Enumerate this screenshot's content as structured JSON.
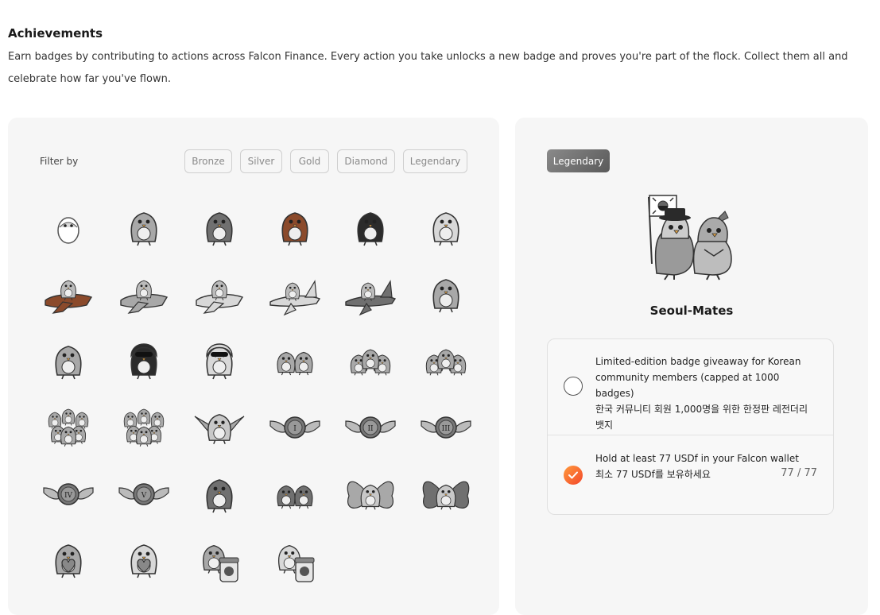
{
  "header": {
    "title": "Achievements",
    "description": "Earn badges by contributing to actions across Falcon Finance. Every action you take unlocks a new badge and proves you're part of the flock. Collect them all and celebrate how far you've flown."
  },
  "filters": {
    "label": "Filter by",
    "options": [
      "Bronze",
      "Silver",
      "Gold",
      "Diamond",
      "Legendary"
    ]
  },
  "badges": [
    {
      "kind": "egg",
      "tone": "light"
    },
    {
      "kind": "falcon",
      "tone": "mid"
    },
    {
      "kind": "falcon",
      "tone": "dark"
    },
    {
      "kind": "falcon",
      "tone": "brown"
    },
    {
      "kind": "falcon",
      "tone": "black"
    },
    {
      "kind": "falcon",
      "tone": "light"
    },
    {
      "kind": "plane",
      "tone": "brown"
    },
    {
      "kind": "plane",
      "tone": "mid"
    },
    {
      "kind": "plane",
      "tone": "light"
    },
    {
      "kind": "jet",
      "tone": "light"
    },
    {
      "kind": "jet",
      "tone": "dark"
    },
    {
      "kind": "falcon",
      "tone": "mid"
    },
    {
      "kind": "falcon",
      "tone": "mid"
    },
    {
      "kind": "hood",
      "tone": "black"
    },
    {
      "kind": "hood",
      "tone": "light"
    },
    {
      "kind": "pair",
      "tone": "mid"
    },
    {
      "kind": "trio",
      "tone": "mid"
    },
    {
      "kind": "trio",
      "tone": "mid"
    },
    {
      "kind": "flock",
      "tone": "mid"
    },
    {
      "kind": "flock",
      "tone": "mid"
    },
    {
      "kind": "wings",
      "tone": "mid"
    },
    {
      "kind": "emblem",
      "tone": "mid",
      "numeral": "I"
    },
    {
      "kind": "emblem",
      "tone": "mid",
      "numeral": "II"
    },
    {
      "kind": "emblem",
      "tone": "mid",
      "numeral": "III"
    },
    {
      "kind": "emblem",
      "tone": "mid",
      "numeral": "IV"
    },
    {
      "kind": "emblem",
      "tone": "mid",
      "numeral": "V"
    },
    {
      "kind": "falcon",
      "tone": "dark"
    },
    {
      "kind": "pair",
      "tone": "dark"
    },
    {
      "kind": "butterfly",
      "tone": "mid"
    },
    {
      "kind": "butterfly",
      "tone": "dark"
    },
    {
      "kind": "heart",
      "tone": "mid"
    },
    {
      "kind": "heart",
      "tone": "light"
    },
    {
      "kind": "jar",
      "tone": "mid"
    },
    {
      "kind": "jar",
      "tone": "light"
    }
  ],
  "detail": {
    "tier": "Legendary",
    "name": "Seoul-Mates",
    "requirements": [
      {
        "completed": false,
        "text": "Limited-edition badge giveaway for Korean community members (capped at 1000 badges)",
        "text_ko": "한국 커뮤니티 회원 1,000명을 위한 한정판 레전더리 뱃지",
        "progress": ""
      },
      {
        "completed": true,
        "text": "Hold at least 77 USDf in your Falcon wallet",
        "text_ko": "최소 77 USDf를 보유하세요",
        "progress": "77 / 77"
      }
    ]
  },
  "colors": {
    "brand_gradient_start": "#ff9a3c",
    "brand_gradient_end": "#f3462b",
    "panel_bg": "#f6f6f6",
    "legendary_tag": "#6e6e6e"
  }
}
